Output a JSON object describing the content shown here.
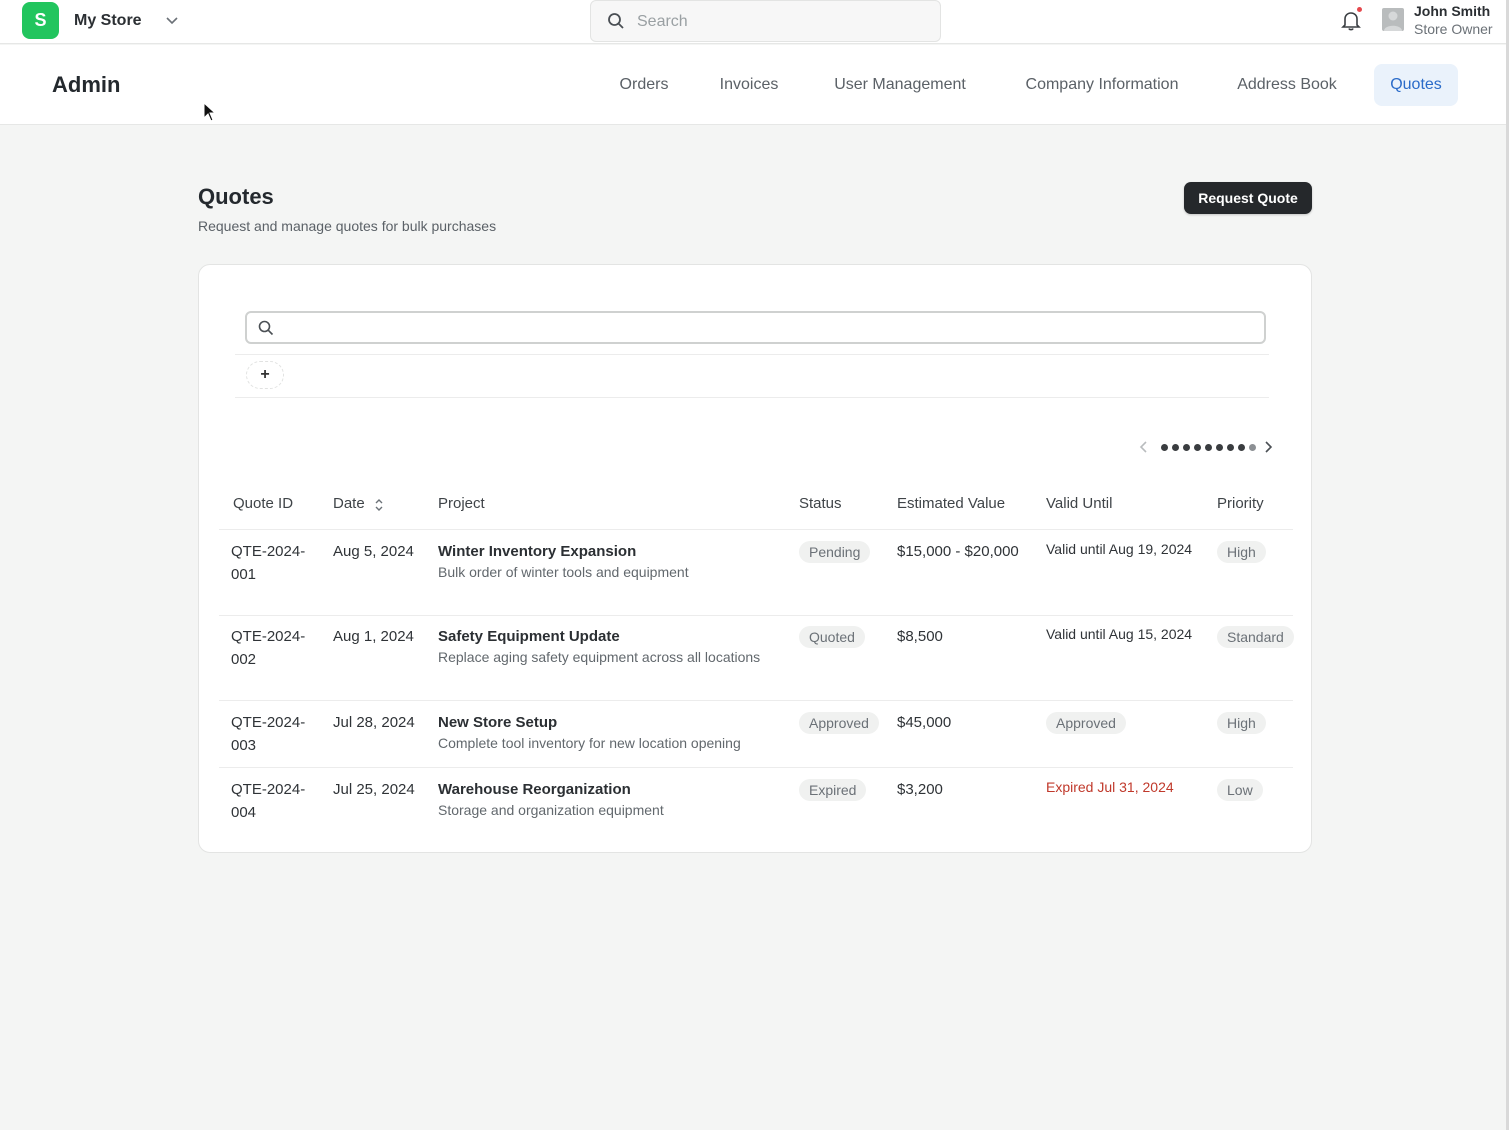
{
  "topbar": {
    "logo_letter": "S",
    "store_name": "My Store",
    "search_placeholder": "Search",
    "user_name": "John Smith",
    "user_role": "Store Owner",
    "accent_color": "#22c55e"
  },
  "admin": {
    "title": "Admin",
    "nav": [
      "Orders",
      "Invoices",
      "User Management",
      "Company Information",
      "Address Book",
      "Quotes"
    ],
    "active_nav": "Quotes"
  },
  "page": {
    "title": "Quotes",
    "subtitle": "Request and manage quotes for bulk purchases",
    "request_button": "Request Quote",
    "add_filter": "+"
  },
  "table": {
    "headers": [
      "Quote ID",
      "Date",
      "Project",
      "Status",
      "Estimated Value",
      "Valid Until",
      "Priority"
    ],
    "rows": [
      {
        "id_line1": "QTE-2024-",
        "id_line2": "001",
        "date": "Aug 5, 2024",
        "project": "Winter Inventory Expansion",
        "description": "Bulk order of winter tools and equipment",
        "status": "Pending",
        "value": "$15,000 - $20,000",
        "valid": "Valid until Aug 19, 2024",
        "priority": "High"
      },
      {
        "id_line1": "QTE-2024-",
        "id_line2": "002",
        "date": "Aug 1, 2024",
        "project": "Safety Equipment Update",
        "description": "Replace aging safety equipment across all locations",
        "status": "Quoted",
        "value": "$8,500",
        "valid": "Valid until Aug 15, 2024",
        "priority": "Standard"
      },
      {
        "id_line1": "QTE-2024-",
        "id_line2": "003",
        "date": "Jul 28, 2024",
        "project": "New Store Setup",
        "description": "Complete tool inventory for new location opening",
        "status": "Approved",
        "value": "$45,000",
        "valid": "Approved",
        "priority": "High"
      },
      {
        "id_line1": "QTE-2024-",
        "id_line2": "004",
        "date": "Jul 25, 2024",
        "project": "Warehouse Reorganization",
        "description": "Storage and organization equipment",
        "status": "Expired",
        "value": "$3,200",
        "valid": "Expired Jul 31, 2024",
        "priority": "Low"
      }
    ]
  },
  "colors": {
    "expired_text": "#c0392b",
    "active_nav_bg": "#eaf2fb",
    "active_nav_text": "#2a6bc9"
  }
}
